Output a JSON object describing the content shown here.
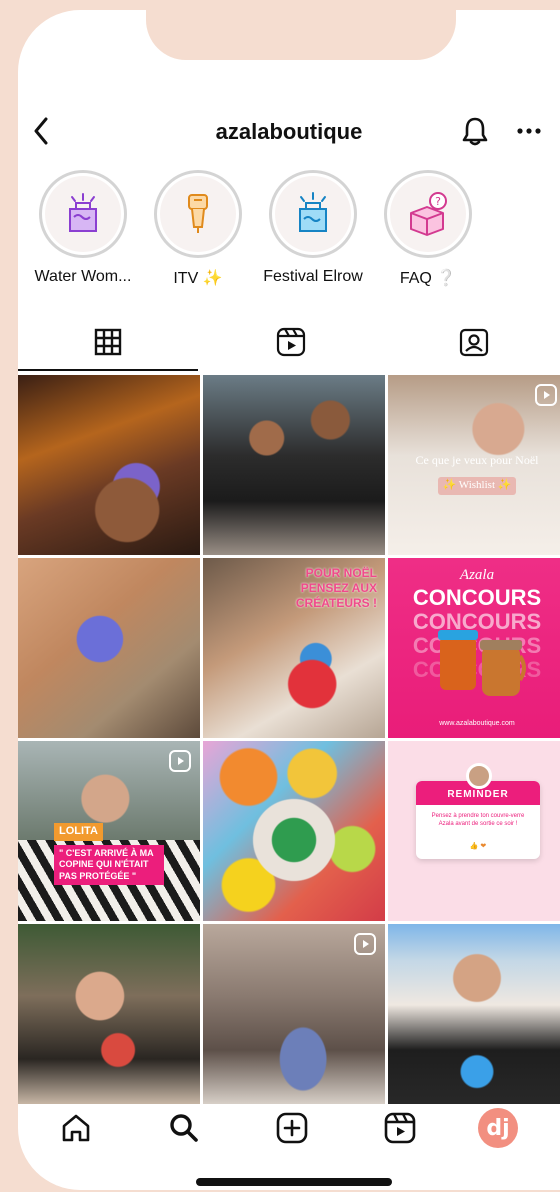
{
  "header": {
    "username": "azalaboutique"
  },
  "highlights": [
    {
      "label": "Water Wom...",
      "icon": "water-bottle-icon",
      "color": "#b56de8"
    },
    {
      "label": "ITV ✨",
      "icon": "microphone-icon",
      "color": "#f5a445"
    },
    {
      "label": "Festival Elrow",
      "icon": "party-bottle-icon",
      "color": "#2aa9e8"
    },
    {
      "label": "FAQ ❔",
      "icon": "question-box-icon",
      "color": "#ee5aa8"
    }
  ],
  "tabs": [
    {
      "name": "grid",
      "icon": "grid-icon",
      "selected": true
    },
    {
      "name": "reels",
      "icon": "reels-icon",
      "selected": false
    },
    {
      "name": "tagged",
      "icon": "tagged-icon",
      "selected": false
    }
  ],
  "posts": {
    "p3_line1": "Ce que je veux pour Noël",
    "p3_line2": "✨ Wishlist ✨",
    "p5_text": "POUR NOËL PENSEZ AUX CRÉATEURS !",
    "p6_script": "Azala",
    "p6_title": "CONCOURS",
    "p6_url": "www.azalaboutique.com",
    "p7_name": "LOLITA",
    "p7_quote": "\" C'EST ARRIVÉ À MA COPINE QUI N'ÉTAIT PAS PROTÉGÉE \"",
    "p9_title": "REMINDER",
    "p9_body": "Pensez à prendre ton couvre-verre Azala avant de sortie ce soir !",
    "p9_emoji": "👍 ❤"
  },
  "bottom_nav": {
    "avatar_text": "dj"
  },
  "colors": {
    "background": "#f5ddd0",
    "pink": "#ec1e7c",
    "accent_orange": "#f29a2e"
  }
}
